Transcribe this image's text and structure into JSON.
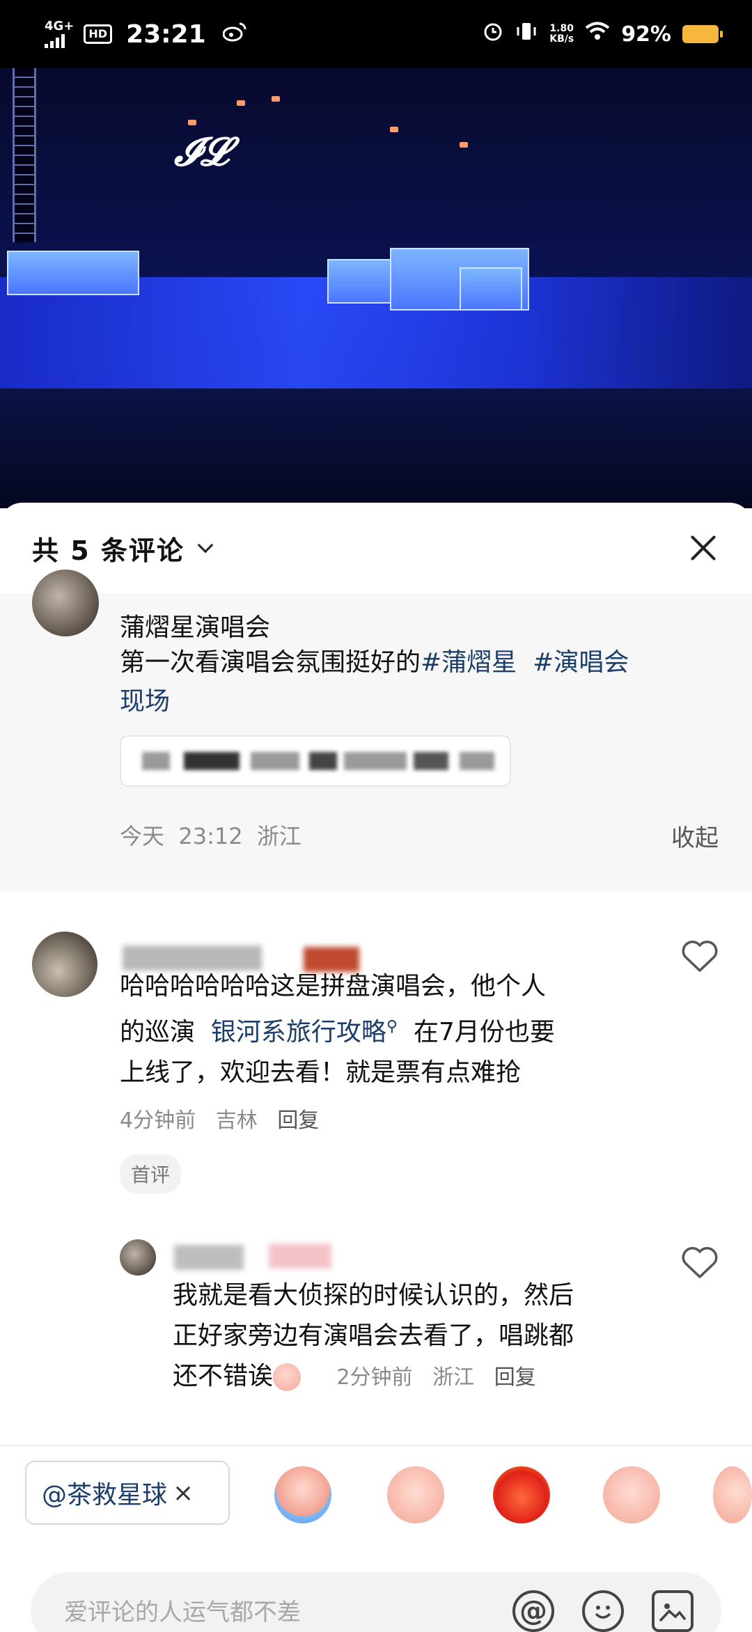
{
  "status_bar": {
    "network": "4G+",
    "hd": "HD",
    "time": "23:21",
    "net_speed_value": "1.80",
    "net_speed_unit": "KB/s",
    "battery_percent": "92%"
  },
  "comments_panel": {
    "title": "共 5 条评论",
    "post": {
      "title": "蒲熠星演唱会",
      "body_prefix": "第一次看演唱会氛围挺好的",
      "hashtags": [
        "#蒲熠星",
        "#演唱会"
      ],
      "body_suffix": "现场",
      "time": "今天",
      "clock": "23:12",
      "location": "浙江",
      "collapse_label": "收起"
    },
    "comment_1": {
      "text_a": "哈哈哈哈哈哈这是拼盘演唱会，他个人",
      "text_b": "的巡演",
      "link": "银河系旅行攻略",
      "text_c": "在7月份也要",
      "text_d": "上线了，欢迎去看！就是票有点难抢",
      "time": "4分钟前",
      "location": "吉林",
      "reply_label": "回复",
      "badge": "首评"
    },
    "reply_1": {
      "text_a": "我就是看大侦探的时候认识的，然后",
      "text_b": "正好家旁边有演唱会去看了，唱跳都",
      "text_c": "还不错诶",
      "time": "2分钟前",
      "location": "浙江",
      "reply_label": "回复"
    }
  },
  "composer": {
    "mention_chip": "@茶救星球",
    "chip_close": "×",
    "placeholder": "爱评论的人运气都不差",
    "at_symbol": "@"
  },
  "colors": {
    "link": "#1b3e6b",
    "battery": "#f6b73c",
    "meta_gray": "#8a8a8a"
  },
  "icons": [
    "weibo-icon",
    "alarm-icon",
    "vibrate-icon",
    "wifi-icon",
    "battery-icon",
    "chevron-down-icon",
    "close-icon",
    "heart-icon",
    "at-icon",
    "emoji-icon",
    "image-icon"
  ]
}
